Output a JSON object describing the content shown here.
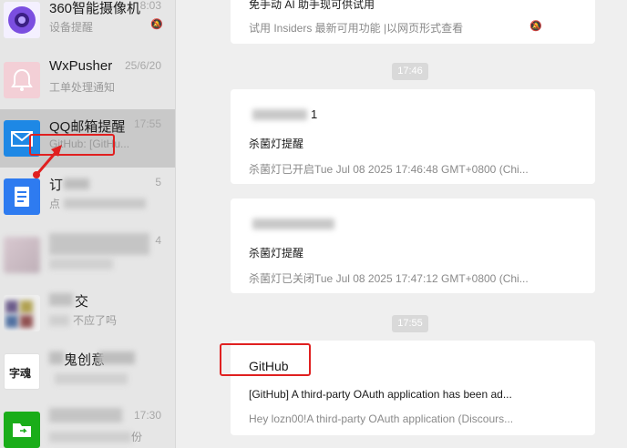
{
  "sidebar": {
    "items": [
      {
        "name": "360智能摄像机",
        "time": "8:03",
        "preview": "设备提醒"
      },
      {
        "name": "WxPusher",
        "time": "25/6/20",
        "preview": "工单处理通知"
      },
      {
        "name": "QQ邮箱提醒",
        "time": "17:55",
        "preview": "GitHub: [GitHu..."
      },
      {
        "name": "订",
        "time": "5",
        "preview": "点"
      },
      {
        "name": "",
        "time": "4",
        "preview": ""
      },
      {
        "name": "交",
        "time": "",
        "preview": "不应了吗"
      },
      {
        "name": "鬼创意",
        "time": "",
        "preview": ""
      },
      {
        "name": "",
        "time": "17:30",
        "preview": "份"
      }
    ],
    "avatar_text_7": "字魂"
  },
  "messages": {
    "top_card": {
      "title": "免手动 AI 助手现可供试用",
      "detail": "试用 Insiders 最新可用功能 |以网页形式查看"
    },
    "time_1": "17:46",
    "card_1": {
      "title": "1",
      "subtitle": "杀菌灯提醒",
      "detail": "杀菌灯已开启Tue Jul 08 2025 17:46:48 GMT+0800 (Chi..."
    },
    "card_2": {
      "title": "",
      "subtitle": "杀菌灯提醒",
      "detail": "杀菌灯已关闭Tue Jul 08 2025 17:47:12 GMT+0800 (Chi..."
    },
    "time_2": "17:55",
    "card_3": {
      "title": "GitHub",
      "subtitle": "[GitHub] A third-party OAuth application has been ad...",
      "detail": "Hey lozn00!A third-party OAuth application (Discours..."
    }
  },
  "colors": {
    "accent_red": "#e02020",
    "qq_blue": "#1e88e5",
    "doc_blue": "#2e7bf0",
    "green": "#1aad19"
  }
}
